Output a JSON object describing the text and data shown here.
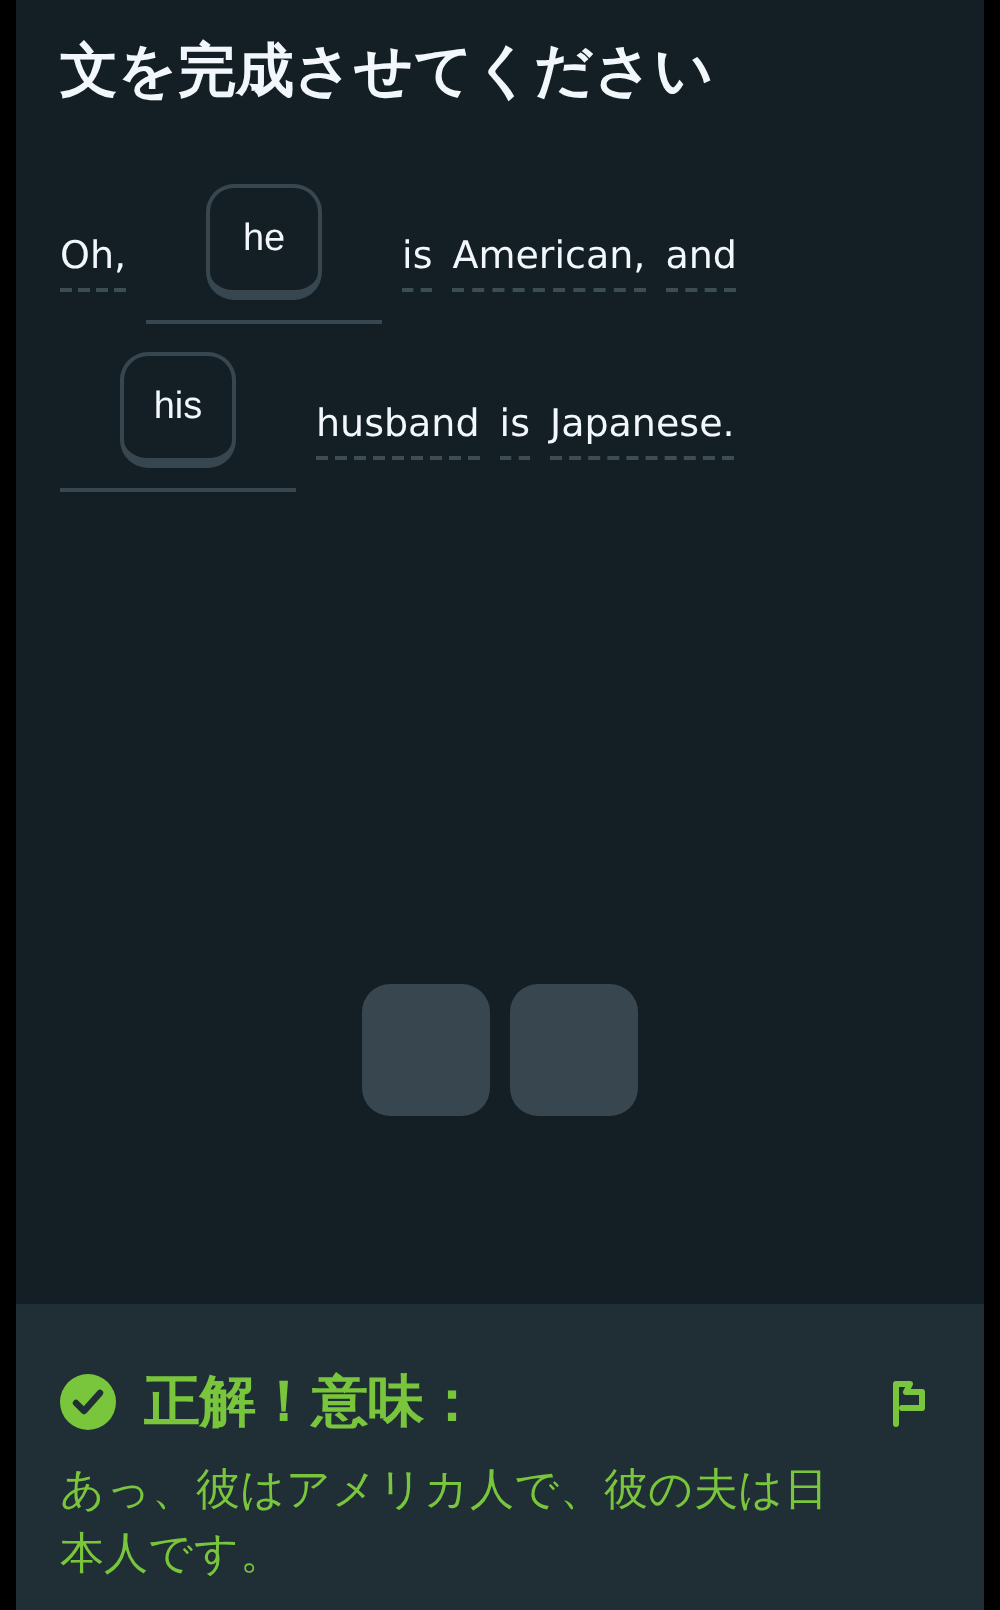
{
  "title": "文を完成させてください",
  "sentence_lines": [
    [
      {
        "kind": "word",
        "text": "Oh,"
      },
      {
        "kind": "blank",
        "text": "he"
      },
      {
        "kind": "word",
        "text": "is"
      },
      {
        "kind": "word",
        "text": "American,"
      },
      {
        "kind": "word",
        "text": "and"
      }
    ],
    [
      {
        "kind": "blank",
        "text": "his"
      },
      {
        "kind": "word",
        "text": "husband"
      },
      {
        "kind": "word",
        "text": "is"
      },
      {
        "kind": "word",
        "text": "Japanese."
      }
    ]
  ],
  "word_bank": [
    {
      "used": true
    },
    {
      "used": true
    }
  ],
  "feedback": {
    "correct": true,
    "heading": "正解！意味：",
    "meaning": "あっ、彼はアメリカ人で、彼の夫は日本人です。"
  }
}
